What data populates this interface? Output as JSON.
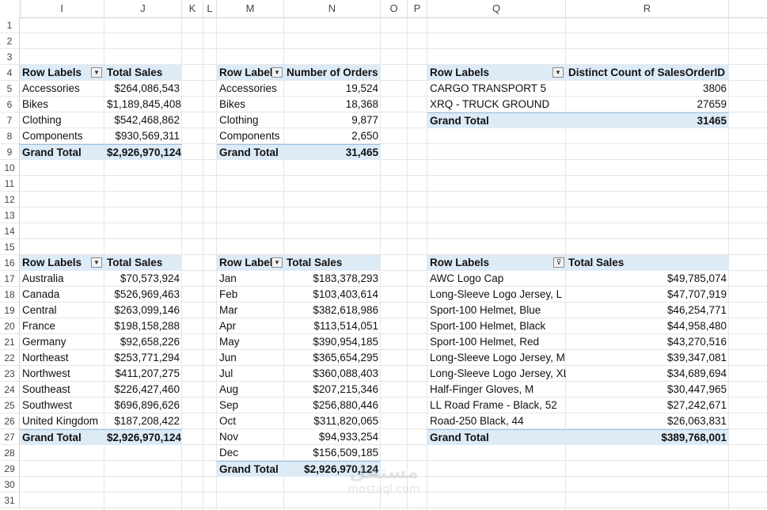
{
  "columns": [
    "I",
    "J",
    "K",
    "L",
    "M",
    "N",
    "O",
    "P",
    "Q",
    "R"
  ],
  "rows": [
    "1",
    "2",
    "3",
    "4",
    "5",
    "6",
    "7",
    "8",
    "9",
    "10",
    "11",
    "12",
    "13",
    "14",
    "15",
    "16",
    "17",
    "18",
    "19",
    "20",
    "21",
    "22",
    "23",
    "24",
    "25",
    "26",
    "27",
    "28",
    "29",
    "30",
    "31"
  ],
  "pivot_category_sales": {
    "h1": "Row Labels",
    "h2": "Total Sales",
    "rows": [
      [
        "Accessories",
        "$264,086,543"
      ],
      [
        "Bikes",
        "$1,189,845,408"
      ],
      [
        "Clothing",
        "$542,468,862"
      ],
      [
        "Components",
        "$930,569,311"
      ]
    ],
    "total_label": "Grand Total",
    "total_value": "$2,926,970,124"
  },
  "pivot_category_orders": {
    "h1": "Row Label",
    "h2": "Number of Orders",
    "rows": [
      [
        "Accessories",
        "19,524"
      ],
      [
        "Bikes",
        "18,368"
      ],
      [
        "Clothing",
        "9,877"
      ],
      [
        "Components",
        "2,650"
      ]
    ],
    "total_label": "Grand Total",
    "total_value": "31,465"
  },
  "pivot_shipmethod": {
    "h1": "Row Labels",
    "h2": "Distinct Count of SalesOrderID",
    "rows": [
      [
        "CARGO TRANSPORT 5",
        "3806"
      ],
      [
        "XRQ - TRUCK GROUND",
        "27659"
      ]
    ],
    "total_label": "Grand Total",
    "total_value": "31465"
  },
  "pivot_region": {
    "h1": "Row Labels",
    "h2": "Total Sales",
    "rows": [
      [
        "Australia",
        "$70,573,924"
      ],
      [
        "Canada",
        "$526,969,463"
      ],
      [
        "Central",
        "$263,099,146"
      ],
      [
        "France",
        "$198,158,288"
      ],
      [
        "Germany",
        "$92,658,226"
      ],
      [
        "Northeast",
        "$253,771,294"
      ],
      [
        "Northwest",
        "$411,207,275"
      ],
      [
        "Southeast",
        "$226,427,460"
      ],
      [
        "Southwest",
        "$696,896,626"
      ],
      [
        "United Kingdom",
        "$187,208,422"
      ]
    ],
    "total_label": "Grand Total",
    "total_value": "$2,926,970,124"
  },
  "pivot_month": {
    "h1": "Row Label",
    "h2": "Total Sales",
    "rows": [
      [
        "Jan",
        "$183,378,293"
      ],
      [
        "Feb",
        "$103,403,614"
      ],
      [
        "Mar",
        "$382,618,986"
      ],
      [
        "Apr",
        "$113,514,051"
      ],
      [
        "May",
        "$390,954,185"
      ],
      [
        "Jun",
        "$365,654,295"
      ],
      [
        "Jul",
        "$360,088,403"
      ],
      [
        "Aug",
        "$207,215,346"
      ],
      [
        "Sep",
        "$256,880,446"
      ],
      [
        "Oct",
        "$311,820,065"
      ],
      [
        "Nov",
        "$94,933,254"
      ],
      [
        "Dec",
        "$156,509,185"
      ]
    ],
    "total_label": "Grand Total",
    "total_value": "$2,926,970,124"
  },
  "pivot_product": {
    "h1": "Row Labels",
    "h2": "Total Sales",
    "rows": [
      [
        "AWC Logo Cap",
        "$49,785,074"
      ],
      [
        "Long-Sleeve Logo Jersey, L",
        "$47,707,919"
      ],
      [
        "Sport-100 Helmet, Blue",
        "$46,254,771"
      ],
      [
        "Sport-100 Helmet, Black",
        "$44,958,480"
      ],
      [
        "Sport-100 Helmet, Red",
        "$43,270,516"
      ],
      [
        "Long-Sleeve Logo Jersey, M",
        "$39,347,081"
      ],
      [
        "Long-Sleeve Logo Jersey, XL",
        "$34,689,694"
      ],
      [
        "Half-Finger Gloves, M",
        "$30,447,965"
      ],
      [
        "LL Road Frame - Black, 52",
        "$27,242,671"
      ],
      [
        "Road-250 Black, 44",
        "$26,063,831"
      ]
    ],
    "total_label": "Grand Total",
    "total_value": "$389,768,001"
  },
  "filter_icons": {
    "dropdown": "dropdown-arrow-icon",
    "filtered": "filter-sort-icon"
  },
  "watermark": {
    "big": "مستقل",
    "small": "mostaql.com"
  }
}
